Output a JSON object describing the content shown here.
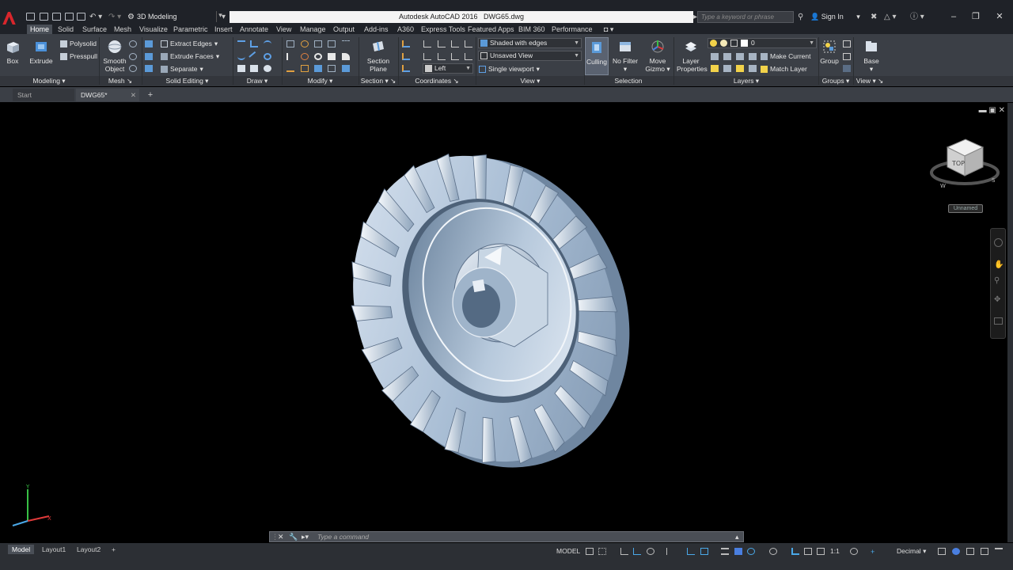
{
  "app": {
    "title": "Autodesk AutoCAD 2016",
    "document": "DWG65.dwg",
    "workspace": "3D Modeling",
    "search_placeholder": "Type a keyword or phrase",
    "sign_in": "Sign In"
  },
  "ribbon_tabs": [
    "Home",
    "Solid",
    "Surface",
    "Mesh",
    "Visualize",
    "Parametric",
    "Insert",
    "Annotate",
    "View",
    "Manage",
    "Output",
    "Add-ins",
    "A360",
    "Express Tools",
    "Featured Apps",
    "BIM 360",
    "Performance"
  ],
  "ribbon": {
    "modeling": {
      "label": "Modeling",
      "box": "Box",
      "extrude": "Extrude",
      "polysolid": "Polysolid",
      "presspull": "Presspull"
    },
    "mesh": {
      "label": "Mesh",
      "smooth_object_1": "Smooth",
      "smooth_object_2": "Object"
    },
    "solid_editing": {
      "label": "Solid Editing",
      "extract_edges": "Extract Edges",
      "extrude_faces": "Extrude Faces",
      "separate": "Separate"
    },
    "draw": {
      "label": "Draw"
    },
    "modify": {
      "label": "Modify"
    },
    "section": {
      "label": "Section",
      "plane_1": "Section",
      "plane_2": "Plane"
    },
    "coordinates": {
      "label": "Coordinates",
      "ucs_combo": "Left"
    },
    "view": {
      "label": "View",
      "visual_style": "Shaded with edges",
      "named_view": "Unsaved View",
      "viewport": "Single viewport"
    },
    "selection": {
      "label": "Selection",
      "culling": "Culling",
      "no_filter_1": "No Filter",
      "move_gizmo_1": "Move",
      "move_gizmo_2": "Gizmo"
    },
    "layers": {
      "label": "Layers",
      "layer_combo": "0",
      "make_current": "Make Current",
      "match_layer": "Match Layer",
      "layer_properties_1": "Layer",
      "layer_properties_2": "Properties"
    },
    "groups": {
      "label": "Groups",
      "group": "Group"
    },
    "view2": {
      "label": "View",
      "base": "Base"
    }
  },
  "file_tabs": {
    "start": "Start",
    "active": "DWG65*"
  },
  "viewcube": {
    "face": "TOP",
    "named_view": "Unnamed"
  },
  "command": {
    "placeholder": "Type a command"
  },
  "layout_tabs": [
    "Model",
    "Layout1",
    "Layout2"
  ],
  "status": {
    "model": "MODEL",
    "scale": "1:1",
    "units": "Decimal"
  },
  "colors": {
    "accent_blue": "#0e74c9",
    "titlebar": "#1f2228",
    "ribbon": "#3b3f46",
    "model_surface": "#a8bdd4"
  }
}
